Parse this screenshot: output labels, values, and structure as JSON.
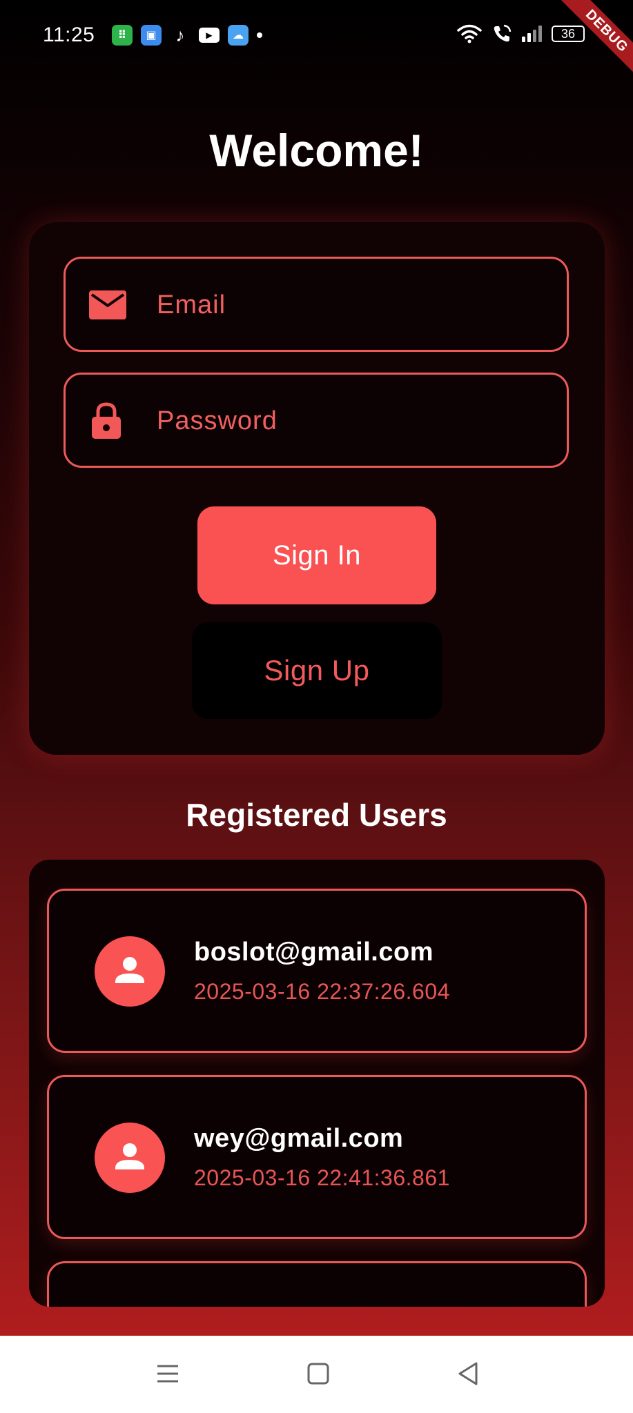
{
  "status_bar": {
    "time": "11:25",
    "battery": "36"
  },
  "debug_banner": "DEBUG",
  "title": "Welcome!",
  "form": {
    "email_placeholder": "Email",
    "password_placeholder": "Password",
    "sign_in_label": "Sign In",
    "sign_up_label": "Sign Up"
  },
  "registered_users": {
    "title": "Registered Users",
    "users": [
      {
        "email": "boslot@gmail.com",
        "date": "2025-03-16 22:37:26.604"
      },
      {
        "email": "wey@gmail.com",
        "date": "2025-03-16 22:41:36.861"
      }
    ]
  },
  "colors": {
    "accent": "#fa5252",
    "background_top": "#000000",
    "background_bottom": "#b01d1e"
  },
  "icons": {
    "email_field": "mail-icon",
    "password_field": "lock-icon",
    "avatar": "person-icon"
  }
}
